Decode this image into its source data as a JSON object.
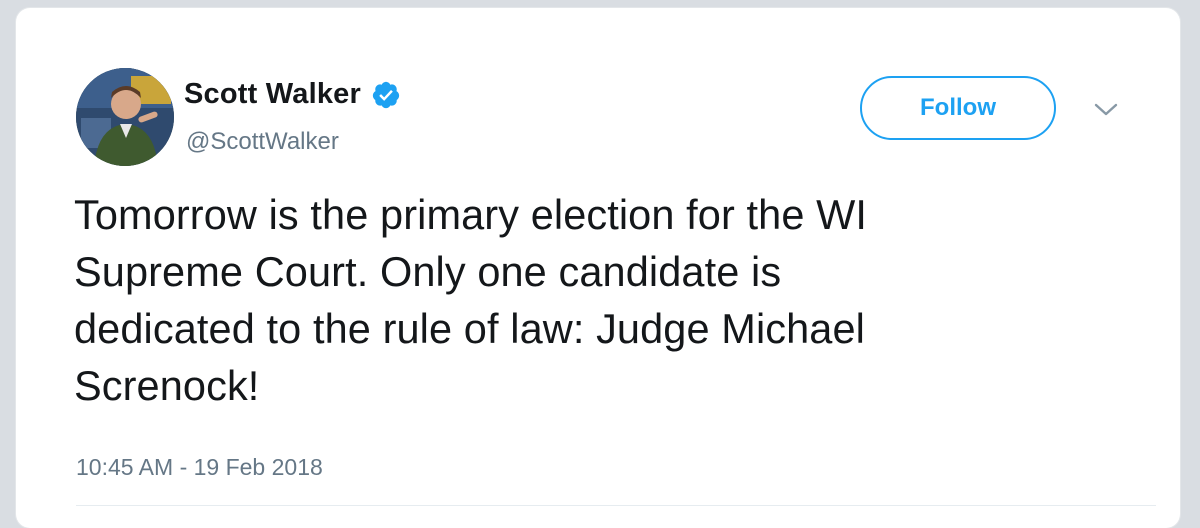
{
  "tweet": {
    "author": {
      "display_name": "Scott Walker",
      "handle": "@ScottWalker",
      "verified": true,
      "avatar_icon": "profile-photo"
    },
    "follow_label": "Follow",
    "menu_icon": "chevron-down-icon",
    "text_lines": [
      "Tomorrow is the primary election for the WI",
      "Supreme Court. Only one candidate is",
      "dedicated to the rule of law: Judge Michael",
      "Screnock!"
    ],
    "timestamp": "10:45 AM - 19 Feb 2018"
  },
  "colors": {
    "accent": "#1da1f2",
    "text_primary": "#14171a",
    "text_secondary": "#657786",
    "background": "#d9dde2"
  }
}
